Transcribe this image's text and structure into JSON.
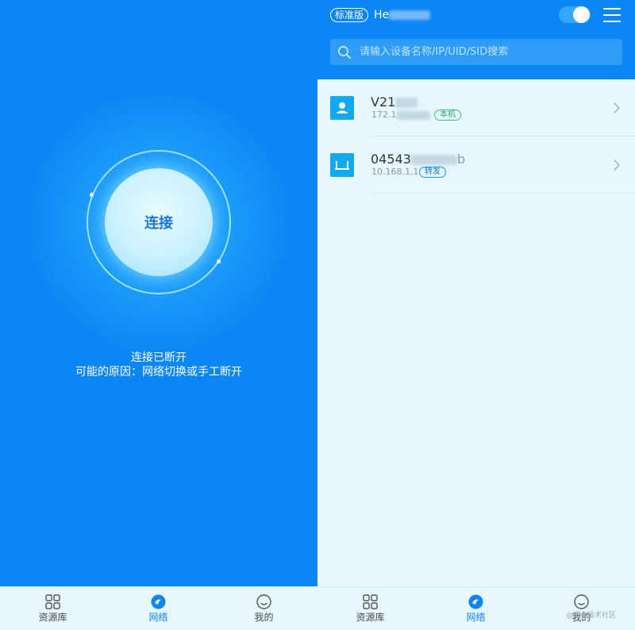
{
  "left_screen": {
    "connect_button_label": "连接",
    "status_title": "连接已断开",
    "status_reason": "可能的原因：网络切换或手工断开"
  },
  "right_screen": {
    "header": {
      "edition_badge": "标准版",
      "user_name_visible": "He",
      "toggle_on": true
    },
    "search": {
      "placeholder": "请输入设备名称/IP/UID/SID搜索"
    },
    "devices": [
      {
        "name_visible": "V21",
        "ip_visible": "172.1",
        "tag": "本机",
        "icon": "user-device-icon"
      },
      {
        "name_visible": "04543",
        "name_suffix": "b",
        "ip_visible": "10.168.1.1",
        "tag": "转发",
        "icon": "router-icon"
      }
    ]
  },
  "bottom_nav": {
    "items": [
      {
        "label": "资源库",
        "icon": "grid-icon",
        "active": false
      },
      {
        "label": "网络",
        "icon": "network-icon",
        "active": true
      },
      {
        "label": "我的",
        "icon": "profile-icon",
        "active": false
      }
    ]
  },
  "watermark": "@掘金技术社区",
  "colors": {
    "primary_blue": "#0a86f5",
    "list_background": "#e6f7fd",
    "local_tag_green": "#38c08f",
    "relay_tag_blue": "#1f97e6"
  }
}
